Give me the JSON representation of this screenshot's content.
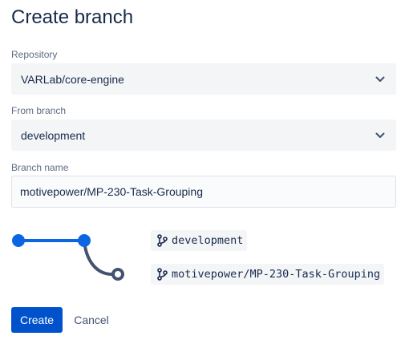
{
  "dialog": {
    "title": "Create branch"
  },
  "repository": {
    "label": "Repository",
    "value": "VARLab/core-engine"
  },
  "from_branch": {
    "label": "From branch",
    "value": "development"
  },
  "branch_name": {
    "label": "Branch name",
    "value": "motivepower/MP-230-Task-Grouping"
  },
  "diagram": {
    "source_branch": "development",
    "new_branch": "motivepower/MP-230-Task-Grouping",
    "colors": {
      "source_line": "#0C66E4",
      "new_branch_line": "#44546F"
    }
  },
  "actions": {
    "create_label": "Create",
    "cancel_label": "Cancel"
  },
  "colors": {
    "primary": "#0052CC",
    "field_bg": "#F4F5F7",
    "text": "#172B4D",
    "label": "#5E6C84"
  },
  "icons": {
    "select_indicator": "chevron-down-icon",
    "branch": "git-branch-icon"
  }
}
